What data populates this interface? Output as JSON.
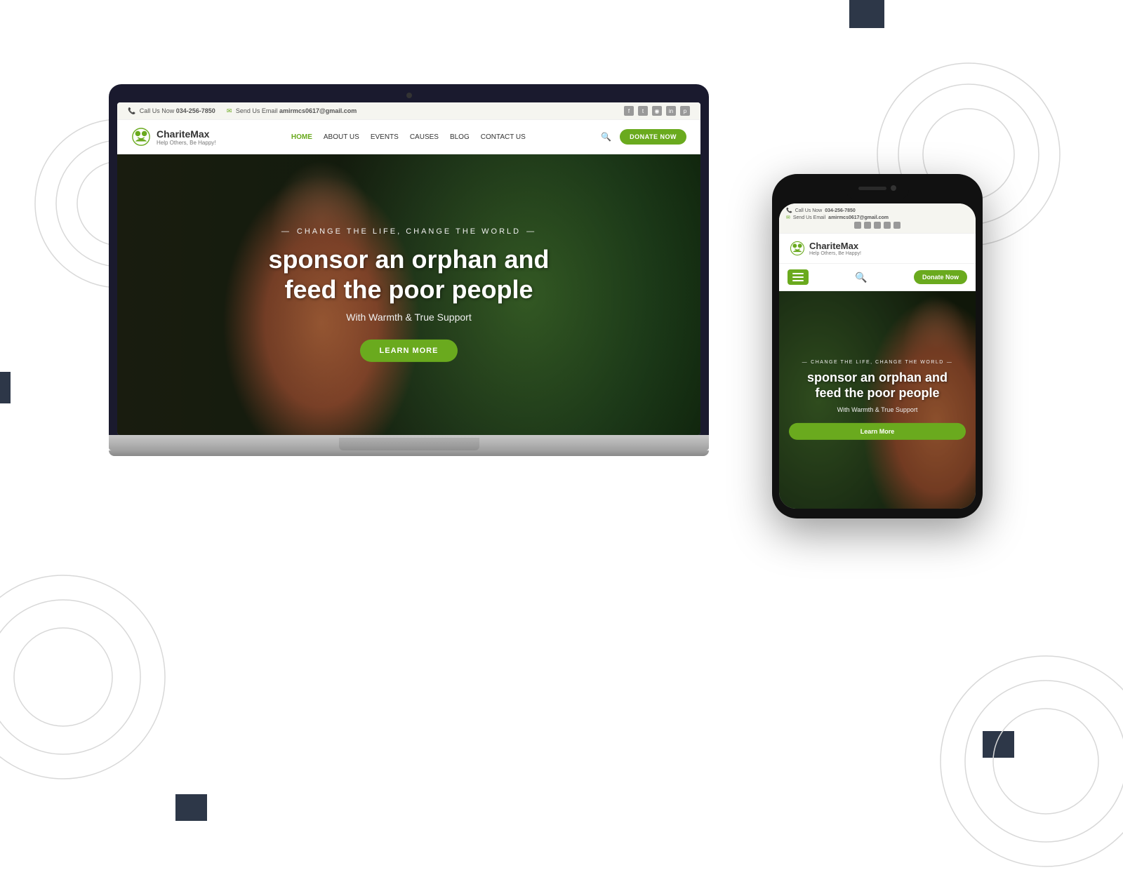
{
  "background": {
    "color": "#ffffff"
  },
  "decorations": {
    "dark_rects": [
      "top-right",
      "bottom-right",
      "bottom-left",
      "left-middle"
    ]
  },
  "laptop": {
    "topbar": {
      "phone_label": "Call Us Now",
      "phone_number": "034-256-7850",
      "email_label": "Send Us Email",
      "email_address": "amirmcs0617@gmail.com"
    },
    "navbar": {
      "logo_name": "ChariteMax",
      "logo_tagline": "Help Others, Be Happy!",
      "links": [
        "HOME",
        "ABOUT US",
        "EVENTS",
        "CAUSES",
        "BLOG",
        "CONTACT US"
      ],
      "donate_button": "DONATE NOW"
    },
    "hero": {
      "subtitle": "CHANGE THE LIFE, CHANGE THE WORLD",
      "title_line1": "sponsor an orphan and",
      "title_line2": "feed the poor people",
      "description": "With Warmth & True Support",
      "button": "LEARN MORE"
    }
  },
  "phone": {
    "topbar": {
      "phone_label": "Call Us Now",
      "phone_number": "034-256-7850",
      "email_label": "Send Us Email",
      "email_address": "amirmcs0617@gmail.com"
    },
    "logo": {
      "name": "ChariteMax",
      "tagline": "Help Others, Be Happy!"
    },
    "navbar": {
      "donate_button": "Donate Now"
    },
    "hero": {
      "subtitle": "CHANGE THE LIFE, CHANGE THE WORLD",
      "title_line1": "sponsor an orphan and",
      "title_line2": "feed the poor people",
      "description": "With Warmth & True Support",
      "button": "Learn More"
    }
  },
  "colors": {
    "green": "#6aaa1e",
    "dark": "#1a1a2e",
    "gray_dark": "#2d3748"
  }
}
